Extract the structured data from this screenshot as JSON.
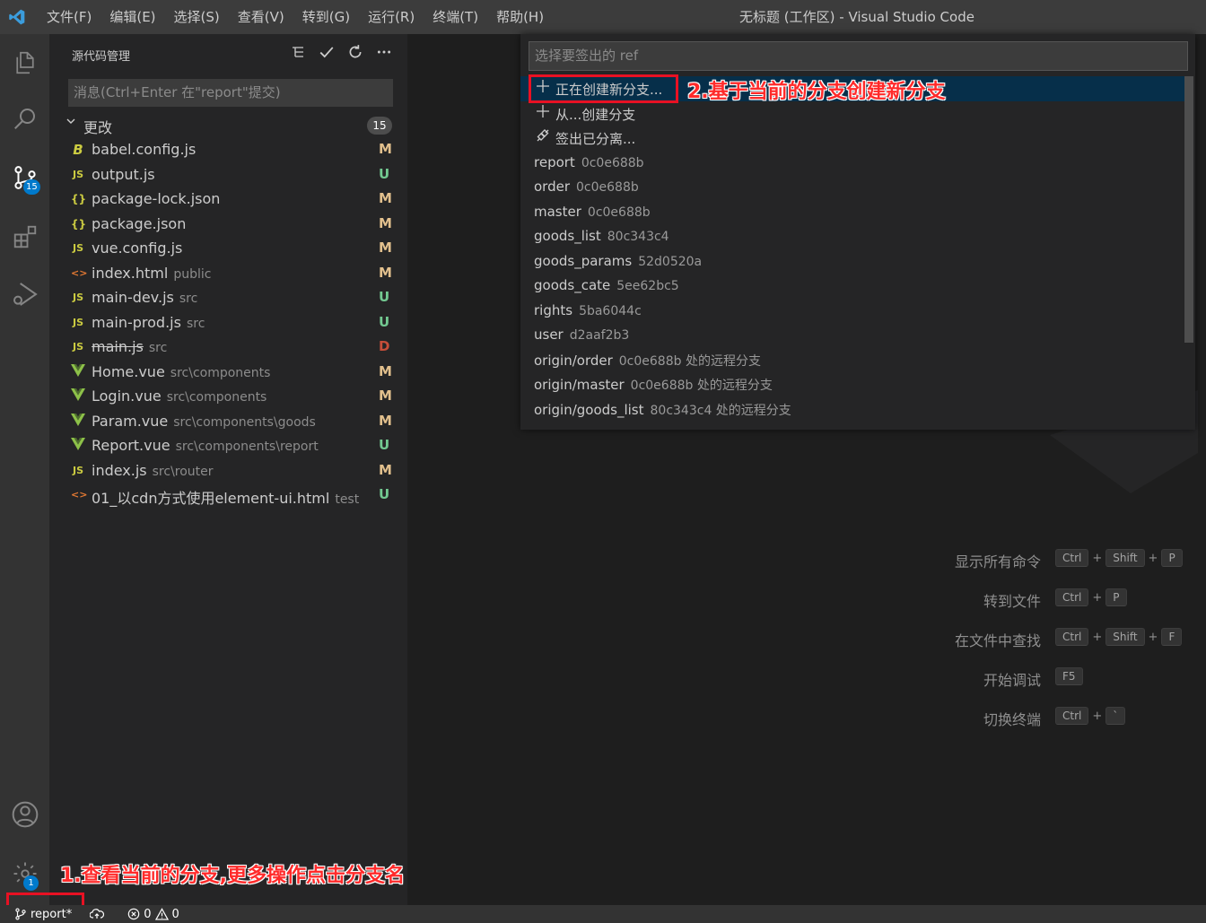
{
  "titlebar": {
    "menu": [
      "文件(F)",
      "编辑(E)",
      "选择(S)",
      "查看(V)",
      "转到(G)",
      "运行(R)",
      "终端(T)",
      "帮助(H)"
    ],
    "window_title": "无标题 (工作区) - Visual Studio Code"
  },
  "activity": {
    "scm_badge": "15",
    "settings_badge": "1"
  },
  "sidebar": {
    "title": "源代码管理",
    "commit_placeholder": "消息(Ctrl+Enter 在\"report\"提交)",
    "changes_label": "更改",
    "changes_count": "15",
    "files": [
      {
        "name": "babel.config.js",
        "path": "",
        "status": "M",
        "icon": "babel-icon"
      },
      {
        "name": "output.js",
        "path": "",
        "status": "U",
        "icon": "js-icon"
      },
      {
        "name": "package-lock.json",
        "path": "",
        "status": "M",
        "icon": "json-icon"
      },
      {
        "name": "package.json",
        "path": "",
        "status": "M",
        "icon": "json-icon"
      },
      {
        "name": "vue.config.js",
        "path": "",
        "status": "M",
        "icon": "js-icon"
      },
      {
        "name": "index.html",
        "path": "public",
        "status": "M",
        "icon": "html-icon"
      },
      {
        "name": "main-dev.js",
        "path": "src",
        "status": "U",
        "icon": "js-icon"
      },
      {
        "name": "main-prod.js",
        "path": "src",
        "status": "U",
        "icon": "js-icon"
      },
      {
        "name": "main.js",
        "path": "src",
        "status": "D",
        "icon": "js-icon"
      },
      {
        "name": "Home.vue",
        "path": "src\\components",
        "status": "M",
        "icon": "vue-icon"
      },
      {
        "name": "Login.vue",
        "path": "src\\components",
        "status": "M",
        "icon": "vue-icon"
      },
      {
        "name": "Param.vue",
        "path": "src\\components\\goods",
        "status": "M",
        "icon": "vue-icon"
      },
      {
        "name": "Report.vue",
        "path": "src\\components\\report",
        "status": "U",
        "icon": "vue-icon"
      },
      {
        "name": "index.js",
        "path": "src\\router",
        "status": "M",
        "icon": "js-icon"
      },
      {
        "name": "01_以cdn方式使用element-ui.html",
        "path": "test",
        "status": "U",
        "icon": "html-icon"
      }
    ]
  },
  "quickpick": {
    "placeholder": "选择要签出的 ref",
    "items": [
      {
        "label": "正在创建新分支...",
        "desc": "",
        "icon": "plus-icon",
        "active": true
      },
      {
        "label": "从...创建分支",
        "desc": "",
        "icon": "plus-icon",
        "active": false
      },
      {
        "label": "签出已分离...",
        "desc": "",
        "icon": "debug-disconnect-icon",
        "active": false
      },
      {
        "label": "report",
        "desc": "0c0e688b",
        "icon": "",
        "active": false
      },
      {
        "label": "order",
        "desc": "0c0e688b",
        "icon": "",
        "active": false
      },
      {
        "label": "master",
        "desc": "0c0e688b",
        "icon": "",
        "active": false
      },
      {
        "label": "goods_list",
        "desc": "80c343c4",
        "icon": "",
        "active": false
      },
      {
        "label": "goods_params",
        "desc": "52d0520a",
        "icon": "",
        "active": false
      },
      {
        "label": "goods_cate",
        "desc": "5ee62bc5",
        "icon": "",
        "active": false
      },
      {
        "label": "rights",
        "desc": "5ba6044c",
        "icon": "",
        "active": false
      },
      {
        "label": "user",
        "desc": "d2aaf2b3",
        "icon": "",
        "active": false
      },
      {
        "label": "origin/order",
        "desc": "0c0e688b 处的远程分支",
        "icon": "",
        "active": false
      },
      {
        "label": "origin/master",
        "desc": "0c0e688b 处的远程分支",
        "icon": "",
        "active": false
      },
      {
        "label": "origin/goods_list",
        "desc": "80c343c4 处的远程分支",
        "icon": "",
        "active": false
      }
    ]
  },
  "shortcuts": [
    {
      "label": "显示所有命令",
      "keys": [
        "Ctrl",
        "Shift",
        "P"
      ]
    },
    {
      "label": "转到文件",
      "keys": [
        "Ctrl",
        "P"
      ]
    },
    {
      "label": "在文件中查找",
      "keys": [
        "Ctrl",
        "Shift",
        "F"
      ]
    },
    {
      "label": "开始调试",
      "keys": [
        "F5"
      ]
    },
    {
      "label": "切换终端",
      "keys": [
        "Ctrl",
        "`"
      ]
    }
  ],
  "annotations": {
    "note1": "1.查看当前的分支,更多操作点击分支名",
    "note2": "2.基于当前的分支创建新分支"
  },
  "statusbar": {
    "branch": "report*",
    "errors": "0",
    "warnings": "0"
  },
  "colors": {
    "status_M": "#e2c08d",
    "status_U": "#73c991",
    "status_D": "#c74e39",
    "accent": "#007acc",
    "annotation": "#e81123"
  }
}
